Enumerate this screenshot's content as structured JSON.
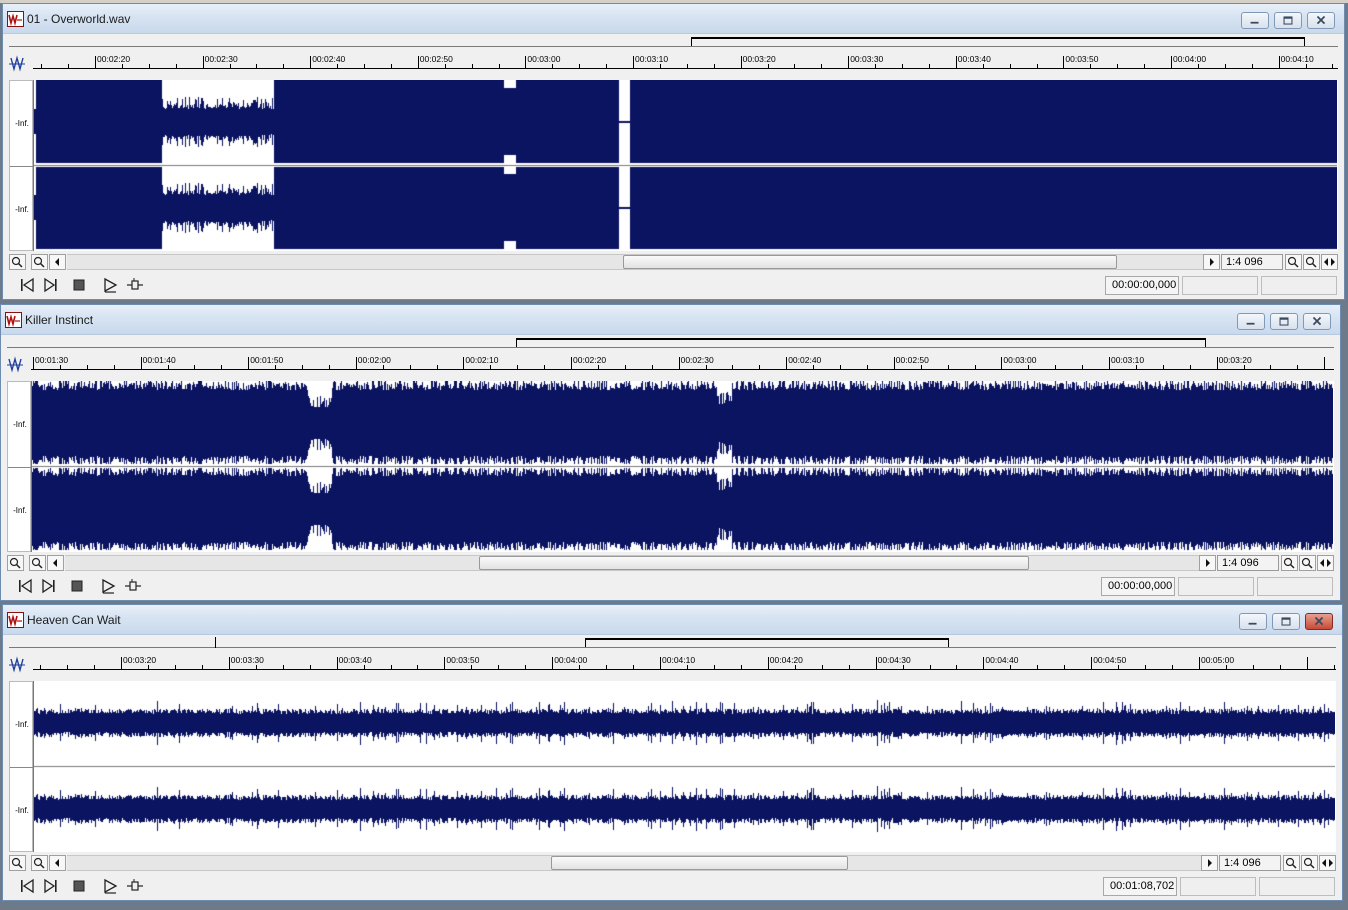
{
  "windows": [
    {
      "id": "overworld",
      "title": "01 - Overworld.wav",
      "active": false,
      "ticks": [
        "00:02:20",
        "00:02:30",
        "00:02:40",
        "00:02:50",
        "00:03:00",
        "00:03:10",
        "00:03:20",
        "00:03:30",
        "00:03:40",
        "00:03:50",
        "00:04:00",
        "00:04:10"
      ],
      "db_top": "-Inf.",
      "db_bottom": "-Inf.",
      "zoom": "1:4 096",
      "time": "00:00:00,000"
    },
    {
      "id": "killer",
      "title": "Killer Instinct",
      "active": false,
      "ticks": [
        "00:01:30",
        "00:01:40",
        "00:01:50",
        "00:02:00",
        "00:02:10",
        "00:02:20",
        "00:02:30",
        "00:02:40",
        "00:02:50",
        "00:03:00",
        "00:03:10",
        "00:03:20"
      ],
      "db_top": "-Inf.",
      "db_bottom": "-Inf.",
      "zoom": "1:4 096",
      "time": "00:00:00,000"
    },
    {
      "id": "heaven",
      "title": "Heaven Can Wait",
      "active": true,
      "ticks": [
        "00:03:20",
        "00:03:30",
        "00:03:40",
        "00:03:50",
        "00:04:00",
        "00:04:10",
        "00:04:20",
        "00:04:30",
        "00:04:40",
        "00:04:50",
        "00:05:00"
      ],
      "db_top": "-Inf.",
      "db_bottom": "-Inf.",
      "zoom": "1:4 096",
      "time": "00:01:08,702"
    }
  ],
  "colors": {
    "waveform": "#0b1460",
    "waveform_bg": "#ffffff"
  },
  "icons": {
    "app": "wavelab-icon",
    "minimize": "minimize-icon",
    "maximize": "maximize-icon",
    "close": "close-icon",
    "zoom": "magnifier-icon",
    "prev": "go-to-start-icon",
    "next": "go-to-end-icon",
    "stop": "stop-icon",
    "play": "play-icon",
    "loop": "loop-icon"
  }
}
